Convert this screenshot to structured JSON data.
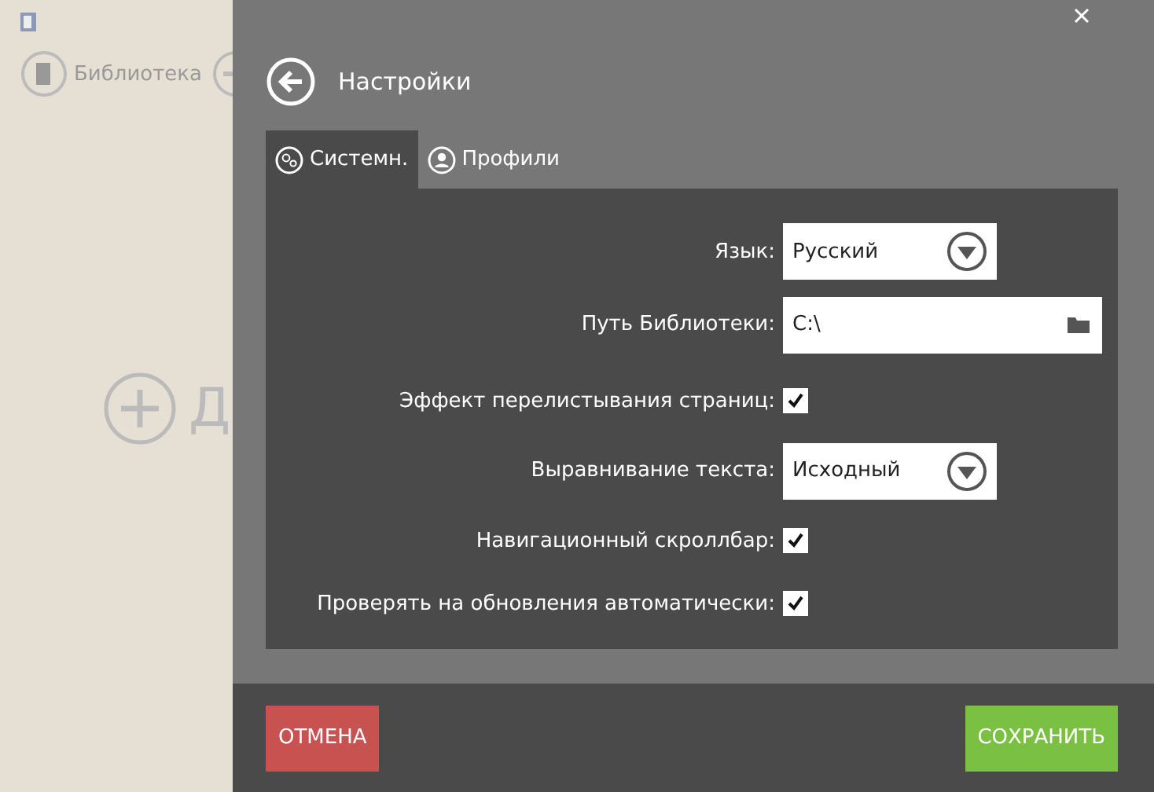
{
  "background": {
    "nav_button": {
      "label": "Библиотека"
    },
    "add_label": "Д"
  },
  "settings": {
    "title": "Настройки",
    "tabs": [
      {
        "label": "Системн.",
        "selected": true
      },
      {
        "label": "Профили",
        "selected": false
      }
    ],
    "rows": [
      {
        "kind": "dropdown",
        "label": "Язык:",
        "value": "Русский"
      },
      {
        "kind": "path",
        "label": "Путь Библиотеки:",
        "value": "C:\\"
      },
      {
        "kind": "checkbox",
        "label": "Эффект перелистывания страниц:",
        "checked": true
      },
      {
        "kind": "dropdown",
        "label": "Выравнивание текста:",
        "value": "Исходный"
      },
      {
        "kind": "checkbox",
        "label": "Навигационный скроллбар:",
        "checked": true
      },
      {
        "kind": "checkbox",
        "label": "Проверять на обновления автоматически:",
        "checked": true
      }
    ],
    "cancel": "ОТМЕНА",
    "save": "СОХРАНИТЬ"
  }
}
